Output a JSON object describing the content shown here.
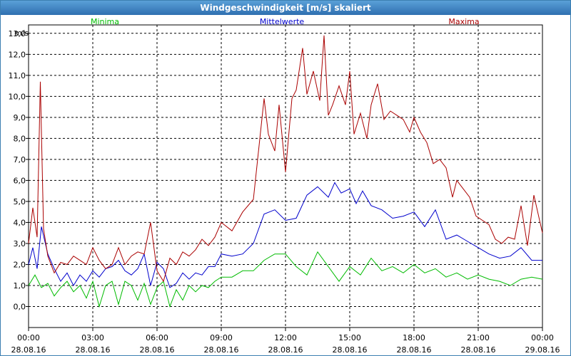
{
  "window": {
    "title": "Windgeschwindigkeit [m/s] skaliert"
  },
  "chart_data": {
    "type": "line",
    "title": "Windgeschwindigkeit [m/s] skaliert",
    "ylabel": "m/s",
    "ylim": [
      -1.0,
      13.4
    ],
    "yticks": [
      "0,0",
      "1,0",
      "2,0",
      "3,0",
      "4,0",
      "5,0",
      "6,0",
      "7,0",
      "8,0",
      "9,0",
      "10,0",
      "11,0",
      "12,0",
      "13,0"
    ],
    "ytick_values": [
      0,
      1,
      2,
      3,
      4,
      5,
      6,
      7,
      8,
      9,
      10,
      11,
      12,
      13
    ],
    "xlim": [
      0,
      24
    ],
    "xticks": [
      {
        "time": "00:00",
        "date": "28.08.16"
      },
      {
        "time": "03:00",
        "date": "28.08.16"
      },
      {
        "time": "06:00",
        "date": "28.08.16"
      },
      {
        "time": "09:00",
        "date": "28.08.16"
      },
      {
        "time": "12:00",
        "date": "28.08.16"
      },
      {
        "time": "15:00",
        "date": "28.08.16"
      },
      {
        "time": "18:00",
        "date": "28.08.16"
      },
      {
        "time": "21:00",
        "date": "28.08.16"
      },
      {
        "time": "00:00",
        "date": "29.08.16"
      }
    ],
    "grid": true,
    "legend_position": "top",
    "series": [
      {
        "name": "Minima",
        "color": "#00bb00",
        "x": [
          0,
          0.3,
          0.6,
          0.9,
          1.2,
          1.5,
          1.8,
          2.1,
          2.4,
          2.7,
          3.0,
          3.3,
          3.6,
          3.9,
          4.2,
          4.5,
          4.8,
          5.1,
          5.4,
          5.7,
          6.0,
          6.3,
          6.6,
          6.9,
          7.2,
          7.5,
          7.8,
          8.1,
          8.4,
          8.7,
          9.0,
          9.5,
          10,
          10.5,
          11,
          11.5,
          12,
          12.5,
          13,
          13.5,
          14,
          14.5,
          15,
          15.5,
          16,
          16.5,
          17,
          17.5,
          18,
          18.5,
          19,
          19.5,
          20,
          20.5,
          21,
          21.5,
          22,
          22.5,
          23,
          23.5,
          24
        ],
        "values": [
          1.0,
          1.5,
          0.9,
          1.1,
          0.5,
          0.9,
          1.2,
          0.7,
          1.0,
          0.4,
          1.2,
          0.0,
          1.0,
          1.2,
          0.1,
          1.2,
          1.0,
          0.3,
          1.1,
          0.1,
          0.9,
          1.2,
          0.0,
          0.8,
          0.3,
          1.0,
          0.7,
          1.0,
          0.9,
          1.2,
          1.4,
          1.4,
          1.7,
          1.7,
          2.2,
          2.5,
          2.5,
          1.9,
          1.5,
          2.6,
          1.9,
          1.2,
          1.9,
          1.5,
          2.3,
          1.7,
          1.9,
          1.6,
          2.0,
          1.6,
          1.8,
          1.4,
          1.6,
          1.3,
          1.5,
          1.3,
          1.2,
          1.0,
          1.3,
          1.4,
          1.3
        ]
      },
      {
        "name": "Mittelwerte",
        "color": "#0000cc",
        "x": [
          0,
          0.2,
          0.4,
          0.6,
          0.9,
          1.2,
          1.5,
          1.8,
          2.1,
          2.4,
          2.7,
          3.0,
          3.3,
          3.6,
          3.9,
          4.2,
          4.5,
          4.8,
          5.1,
          5.4,
          5.7,
          6.0,
          6.3,
          6.6,
          6.9,
          7.2,
          7.5,
          7.8,
          8.1,
          8.4,
          8.7,
          9.0,
          9.5,
          10,
          10.5,
          11,
          11.5,
          12,
          12.5,
          13,
          13.5,
          14,
          14.3,
          14.6,
          15,
          15.3,
          15.6,
          16,
          16.5,
          17,
          17.5,
          18,
          18.5,
          19,
          19.5,
          20,
          20.5,
          21,
          21.5,
          22,
          22.5,
          23,
          23.5,
          24
        ],
        "values": [
          2.0,
          2.8,
          1.8,
          3.8,
          2.5,
          1.8,
          1.2,
          1.6,
          1.0,
          1.5,
          1.2,
          1.7,
          1.4,
          1.8,
          1.9,
          2.2,
          1.7,
          1.5,
          1.8,
          2.5,
          1.0,
          2.1,
          1.8,
          0.9,
          1.1,
          1.6,
          1.3,
          1.6,
          1.5,
          1.9,
          1.9,
          2.5,
          2.4,
          2.5,
          3.0,
          4.4,
          4.6,
          4.1,
          4.2,
          5.3,
          5.7,
          5.2,
          5.9,
          5.4,
          5.6,
          4.9,
          5.5,
          4.8,
          4.6,
          4.2,
          4.3,
          4.5,
          3.8,
          4.6,
          3.2,
          3.4,
          3.1,
          2.8,
          2.5,
          2.3,
          2.4,
          2.8,
          2.2,
          2.2
        ]
      },
      {
        "name": "Maxima",
        "color": "#aa0000",
        "x": [
          0,
          0.2,
          0.4,
          0.55,
          0.7,
          0.9,
          1.2,
          1.5,
          1.8,
          2.1,
          2.4,
          2.7,
          3.0,
          3.3,
          3.6,
          3.9,
          4.2,
          4.5,
          4.8,
          5.1,
          5.4,
          5.7,
          6.0,
          6.3,
          6.6,
          6.9,
          7.2,
          7.5,
          7.8,
          8.1,
          8.4,
          8.7,
          9.0,
          9.5,
          10,
          10.5,
          11,
          11.2,
          11.5,
          11.7,
          12,
          12.3,
          12.5,
          12.8,
          13,
          13.3,
          13.6,
          13.8,
          14,
          14.2,
          14.5,
          14.8,
          15,
          15.2,
          15.5,
          15.8,
          16,
          16.3,
          16.6,
          16.9,
          17.2,
          17.5,
          17.8,
          18,
          18.3,
          18.6,
          18.9,
          19.2,
          19.5,
          19.8,
          20,
          20.3,
          20.6,
          20.9,
          21.2,
          21.5,
          21.8,
          22.1,
          22.4,
          22.7,
          23,
          23.3,
          23.6,
          24
        ],
        "values": [
          3.0,
          4.7,
          3.3,
          10.7,
          3.7,
          2.4,
          1.6,
          2.1,
          2.0,
          2.4,
          2.2,
          2.0,
          2.8,
          2.2,
          1.8,
          2.0,
          2.8,
          2.0,
          2.4,
          2.6,
          2.5,
          4.0,
          1.7,
          1.2,
          2.3,
          2.0,
          2.6,
          2.4,
          2.7,
          3.2,
          2.9,
          3.3,
          4.0,
          3.6,
          4.5,
          5.1,
          9.9,
          8.2,
          7.4,
          9.6,
          6.4,
          9.9,
          10.3,
          12.3,
          10.1,
          11.2,
          9.8,
          12.9,
          9.1,
          9.6,
          10.5,
          9.6,
          11.2,
          8.2,
          9.2,
          8.0,
          9.6,
          10.6,
          8.9,
          9.3,
          9.1,
          8.9,
          8.3,
          9.0,
          8.3,
          7.8,
          6.8,
          7.0,
          6.6,
          5.2,
          6.0,
          5.6,
          5.2,
          4.3,
          4.1,
          3.9,
          3.2,
          3.0,
          3.3,
          3.2,
          4.8,
          2.9,
          5.3,
          3.5
        ]
      }
    ]
  }
}
